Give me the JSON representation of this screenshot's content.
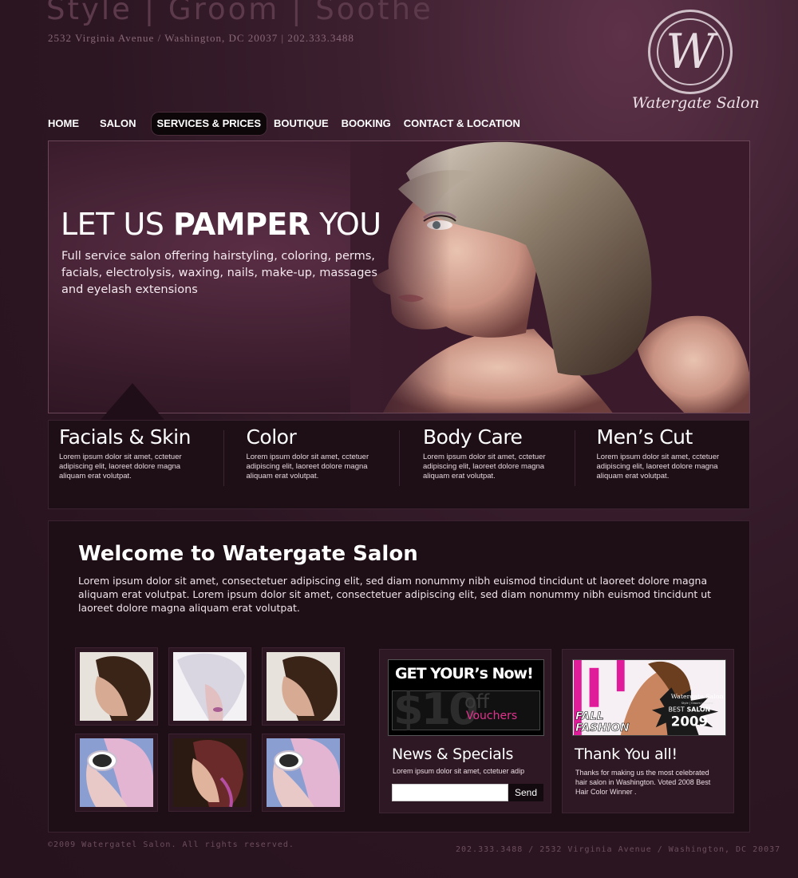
{
  "header": {
    "tagline": "Style | Groom | Soothe",
    "address": "2532 Virginia Avenue / Washington, DC 20037 | 202.333.3488"
  },
  "logo": {
    "letter": "W",
    "name": "Watergate Salon"
  },
  "nav": {
    "items": [
      "HOME",
      "SALON",
      "SERVICES & PRICES",
      "BOUTIQUE",
      "BOOKING",
      "CONTACT & LOCATION"
    ],
    "active": "SERVICES & PRICES"
  },
  "hero": {
    "title_plain_1": "LET US ",
    "title_bold": "PAMPER",
    "title_plain_2": " YOU",
    "text": "Full service salon offering hairstyling, coloring, perms, facials, electrolysis, waxing, nails, make-up, massages and eyelash extensions"
  },
  "services": [
    {
      "title": "Facials & Skin",
      "text": "Lorem ipsum dolor sit amet, cctetuer adipiscing elit, laoreet dolore magna aliquam erat volutpat."
    },
    {
      "title": "Color",
      "text": "Lorem ipsum dolor sit amet, cctetuer adipiscing elit, laoreet dolore magna aliquam erat volutpat."
    },
    {
      "title": "Body Care",
      "text": "Lorem ipsum dolor sit amet, cctetuer adipiscing elit, laoreet dolore magna aliquam erat volutpat."
    },
    {
      "title": "Men’s Cut",
      "text": "Lorem ipsum dolor sit amet, cctetuer adipiscing elit, laoreet dolore magna aliquam erat volutpat."
    }
  ],
  "welcome": {
    "title": "Welcome to Watergate Salon",
    "text": "Lorem ipsum dolor sit amet, consectetuer adipiscing elit, sed diam nonummy nibh euismod tincidunt ut laoreet dolore magna aliquam erat volutpat. Lorem ipsum dolor sit amet, consectetuer adipiscing elit, sed diam nonummy nibh euismod tincidunt ut laoreet dolore magna aliquam erat volutpat."
  },
  "promo": {
    "head": "GET YOUR’s Now!",
    "amount": "$10",
    "off": "off",
    "vouchers": "Vouchers"
  },
  "news": {
    "title": "News & Specials",
    "text": "Lorem ipsum dolor sit amet, cctetuer adip",
    "input_value": "",
    "send_label": "Send"
  },
  "fall_ad": {
    "line1": "FALL",
    "line2": "FASHION",
    "brand": "Watergate Salon",
    "brand_sub": "Style | Groom | Soothe",
    "award_1": "BEST",
    "award_2": "SALON",
    "year": "2009"
  },
  "thanks": {
    "title": "Thank You all!",
    "text": "Thanks for making us the most celebrated hair salon in Washington. Voted 2008 Best Hair Color Winner ."
  },
  "footer": {
    "copyright": "©2009 Watergatel Salon. All rights reserved.",
    "contact": "202.333.3488 / 2532 Virginia Avenue / Washington, DC 20037"
  },
  "colors": {
    "background": "#2c1622",
    "panel": "#1e0f17",
    "accent_pink": "#e2338e"
  }
}
